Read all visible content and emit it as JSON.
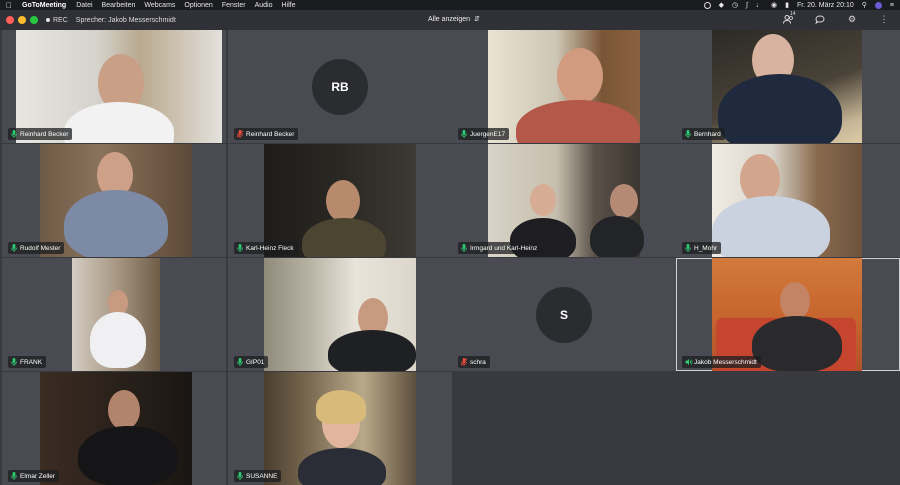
{
  "menubar": {
    "app": "GoToMeeting",
    "items": [
      "Datei",
      "Bearbeiten",
      "Webcams",
      "Optionen",
      "Fenster",
      "Audio",
      "Hilfe"
    ],
    "clock": "Fr. 20. März  20:10"
  },
  "toolbar": {
    "rec": "REC",
    "speaker": "Sprecher: Jakob Messerschmidt",
    "view": "Alle anzeigen",
    "attendee_count": "14"
  },
  "colors": {
    "mic_on": "#2ecc71",
    "mic_muted": "#e74c3c",
    "accent_border": "#cfd3d8"
  },
  "tiles": [
    {
      "name": "Reinhard Becker",
      "mic": "on"
    },
    {
      "name": "Reinhard Becker",
      "mic": "muted",
      "initials": "RB"
    },
    {
      "name": "JuergenE17",
      "mic": "on"
    },
    {
      "name": "Bernhard",
      "mic": "on"
    },
    {
      "name": "Rudolf Mester",
      "mic": "on"
    },
    {
      "name": "Karl-Heinz Fleck",
      "mic": "on"
    },
    {
      "name": "Irmgard und Karl-Heinz",
      "mic": "on"
    },
    {
      "name": "H_Mohr",
      "mic": "on"
    },
    {
      "name": "FRANK",
      "mic": "on"
    },
    {
      "name": "GIP01",
      "mic": "on"
    },
    {
      "name": "schra",
      "mic": "muted",
      "initials": "S"
    },
    {
      "name": "Jakob Messerschmidt",
      "mic": "speaking"
    },
    {
      "name": "Elmar Zeller",
      "mic": "on"
    },
    {
      "name": "SUSANNE",
      "mic": "on"
    }
  ]
}
